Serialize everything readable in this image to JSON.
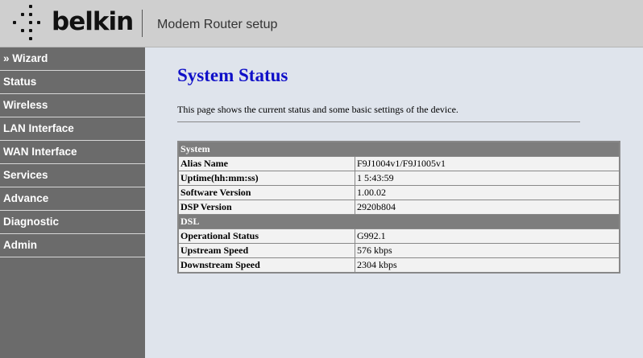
{
  "header": {
    "brand": "belkin",
    "title": "Modem Router setup"
  },
  "sidebar": {
    "items": [
      {
        "label": "» Wizard"
      },
      {
        "label": "Status"
      },
      {
        "label": "Wireless"
      },
      {
        "label": "LAN Interface"
      },
      {
        "label": "WAN Interface"
      },
      {
        "label": "Services"
      },
      {
        "label": "Advance"
      },
      {
        "label": "Diagnostic"
      },
      {
        "label": "Admin"
      }
    ]
  },
  "main": {
    "title": "System Status",
    "description": "This page shows the current status and some basic settings of the device.",
    "sections": [
      {
        "name": "System",
        "rows": [
          {
            "label": "Alias Name",
            "value": "F9J1004v1/F9J1005v1"
          },
          {
            "label": "Uptime(hh:mm:ss)",
            "value": "1 5:43:59"
          },
          {
            "label": "Software Version",
            "value": "1.00.02"
          },
          {
            "label": "DSP Version",
            "value": "2920b804"
          }
        ]
      },
      {
        "name": "DSL",
        "rows": [
          {
            "label": "Operational Status",
            "value": "G992.1"
          },
          {
            "label": "Upstream Speed",
            "value": "576 kbps"
          },
          {
            "label": "Downstream Speed",
            "value": "2304 kbps"
          }
        ]
      }
    ]
  },
  "colors": {
    "title": "#1010c8",
    "sidebar": "#6b6b6b",
    "header": "#cfcfcf",
    "section_row": "#7d7d7d"
  }
}
